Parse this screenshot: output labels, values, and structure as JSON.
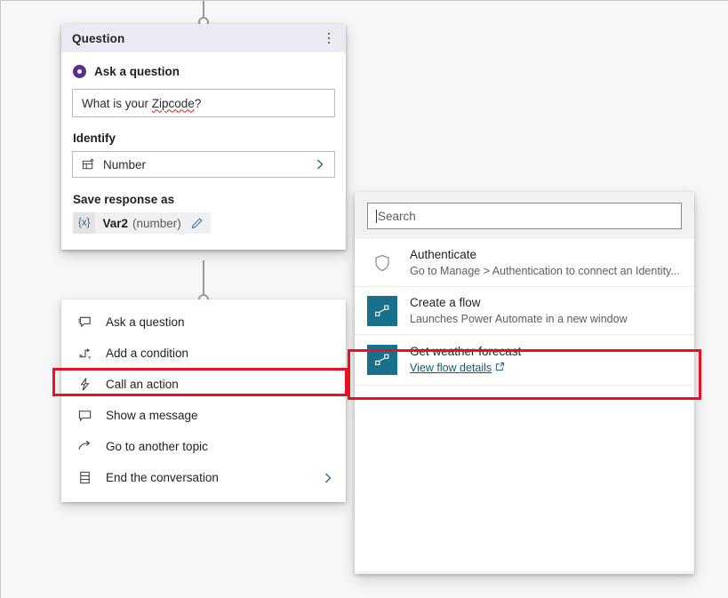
{
  "theme": {
    "accent_purple": "#5b2d8e",
    "flow_teal": "#17708c",
    "highlight_red": "#e81123",
    "link_blue": "#15597a",
    "card_header_bg": "#ebe9f2",
    "panel_bg": "#f3f2f1",
    "canvas_bg": "#f7f7f7"
  },
  "question_card": {
    "title": "Question",
    "overflow_menu": "more-options",
    "ask": {
      "label": "Ask a question",
      "selected": true,
      "value": "What is your Zipcode?",
      "misspelled_word": "Zipcode",
      "value_prefix": "What is your ",
      "value_suffix": "?"
    },
    "identify": {
      "label": "Identify",
      "value": "Number",
      "icon": "entity-number-icon"
    },
    "save_response": {
      "label": "Save response as",
      "badge": "{x}",
      "variable_name": "Var2",
      "variable_type": "(number)",
      "edit_icon": "pencil-icon"
    }
  },
  "node_menu": {
    "items": [
      {
        "label": "Ask a question",
        "icon": "ask-question-icon",
        "has_chevron": false,
        "highlighted": false
      },
      {
        "label": "Add a condition",
        "icon": "condition-branch-icon",
        "has_chevron": false,
        "highlighted": false
      },
      {
        "label": "Call an action",
        "icon": "lightning-bolt-icon",
        "has_chevron": false,
        "highlighted": true
      },
      {
        "label": "Show a message",
        "icon": "message-bubble-icon",
        "has_chevron": false,
        "highlighted": false
      },
      {
        "label": "Go to another topic",
        "icon": "redirect-arrow-icon",
        "has_chevron": false,
        "highlighted": false
      },
      {
        "label": "End the conversation",
        "icon": "end-conversation-icon",
        "has_chevron": true,
        "highlighted": false
      }
    ]
  },
  "flyout": {
    "search": {
      "placeholder": "Search",
      "value": "",
      "focused": true
    },
    "results": [
      {
        "title": "Authenticate",
        "subtitle": "Go to Manage > Authentication to connect an Identity...",
        "icon": "shield-icon",
        "icon_kind": "shield",
        "highlighted": false,
        "link": null
      },
      {
        "title": "Create a flow",
        "subtitle": "Launches Power Automate in a new window",
        "icon": "power-automate-flow-icon",
        "icon_kind": "flow",
        "highlighted": false,
        "link": null
      },
      {
        "title": "Get weather forecast",
        "subtitle": null,
        "icon": "power-automate-flow-icon",
        "icon_kind": "flow",
        "highlighted": true,
        "link": {
          "text": "View flow details",
          "icon": "external-link-icon"
        }
      }
    ]
  }
}
